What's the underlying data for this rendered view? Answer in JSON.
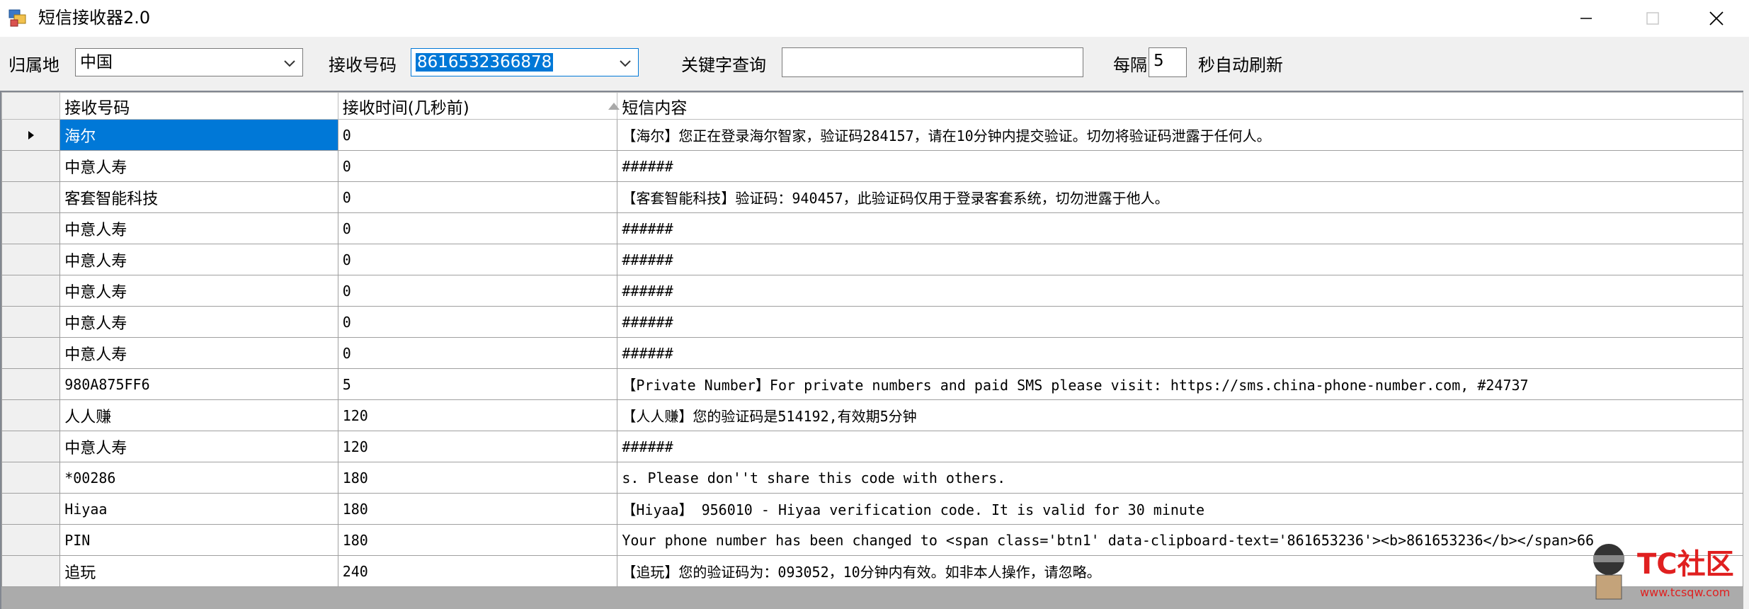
{
  "window": {
    "title": "短信接收器2.0"
  },
  "toolbar": {
    "region_label": "归属地",
    "region_value": "中国",
    "number_label": "接收号码",
    "number_value": "8616532366878",
    "keyword_label": "关键字查询",
    "keyword_value": "",
    "interval_prefix": "每隔",
    "interval_value": "5",
    "interval_suffix": "秒自动刷新"
  },
  "grid": {
    "columns": [
      "接收号码",
      "接收时间(几秒前)",
      "短信内容"
    ],
    "rows": [
      {
        "sender": "海尔",
        "time": "0",
        "content": "【海尔】您正在登录海尔智家，验证码284157，请在10分钟内提交验证。切勿将验证码泄露于任何人。"
      },
      {
        "sender": "中意人寿",
        "time": "0",
        "content": "######"
      },
      {
        "sender": "客套智能科技",
        "time": "0",
        "content": "【客套智能科技】验证码：940457，此验证码仅用于登录客套系统，切勿泄露于他人。"
      },
      {
        "sender": "中意人寿",
        "time": "0",
        "content": "######"
      },
      {
        "sender": "中意人寿",
        "time": "0",
        "content": "######"
      },
      {
        "sender": "中意人寿",
        "time": "0",
        "content": "######"
      },
      {
        "sender": "中意人寿",
        "time": "0",
        "content": "######"
      },
      {
        "sender": "中意人寿",
        "time": "0",
        "content": "######"
      },
      {
        "sender": "980A875FF6",
        "time": "5",
        "content": "【Private Number】For private numbers and paid SMS please visit:  https://sms.china-phone-number.com, #24737"
      },
      {
        "sender": "人人赚",
        "time": "120",
        "content": "【人人赚】您的验证码是514192,有效期5分钟"
      },
      {
        "sender": "中意人寿",
        "time": "120",
        "content": "######"
      },
      {
        "sender": "*00286",
        "time": "180",
        "content": "s. Please don''t share this code with others."
      },
      {
        "sender": "Hiyaa",
        "time": "180",
        "content": "【Hiyaa】 956010 - Hiyaa verification code. It is valid for 30 minute"
      },
      {
        "sender": "PIN",
        "time": "180",
        "content": "Your phone number has been changed to <span class='btn1' data-clipboard-text='861653236'><b>861653236</b></span>66"
      },
      {
        "sender": "追玩",
        "time": "240",
        "content": "【追玩】您的验证码为：093052，10分钟内有效。如非本人操作，请忽略。"
      }
    ]
  },
  "watermark": {
    "brand": "TC社区",
    "url": "www.tcsqw.com"
  },
  "colors": {
    "accent": "#0078d7",
    "watermark_red": "#e02020"
  }
}
